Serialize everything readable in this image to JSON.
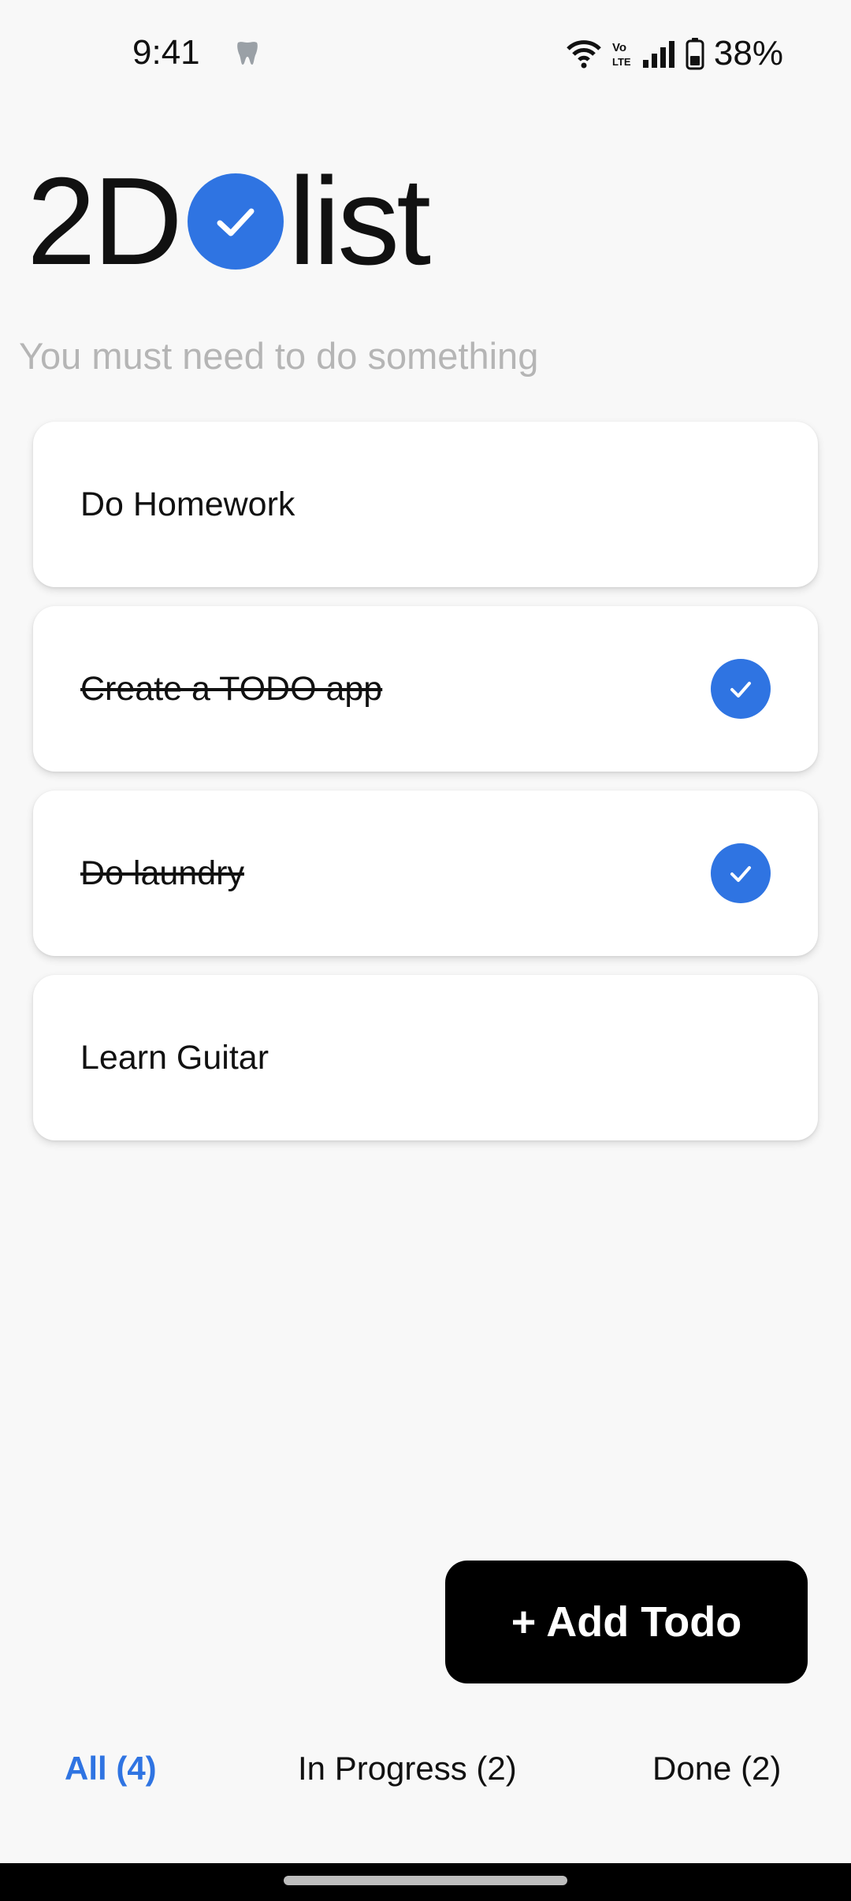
{
  "status_bar": {
    "time": "9:41",
    "battery": "38%",
    "icons": [
      "tooth-icon",
      "wifi-icon",
      "volte-icon",
      "signal-icon",
      "battery-icon"
    ]
  },
  "header": {
    "logo_left": "2D",
    "logo_right": "list",
    "subtitle": "You must need to do something"
  },
  "todos": [
    {
      "label": "Do Homework",
      "done": false
    },
    {
      "label": "Create a TODO app",
      "done": true
    },
    {
      "label": "Do laundry ",
      "done": true
    },
    {
      "label": "Learn Guitar",
      "done": false
    }
  ],
  "actions": {
    "add_label": "+ Add Todo"
  },
  "filters": {
    "all": "All (4)",
    "in_progress": "In Progress (2)",
    "done": "Done (2)",
    "active": "all"
  },
  "colors": {
    "accent": "#2f74e2",
    "background": "#f8f8f8",
    "button": "#000000"
  }
}
